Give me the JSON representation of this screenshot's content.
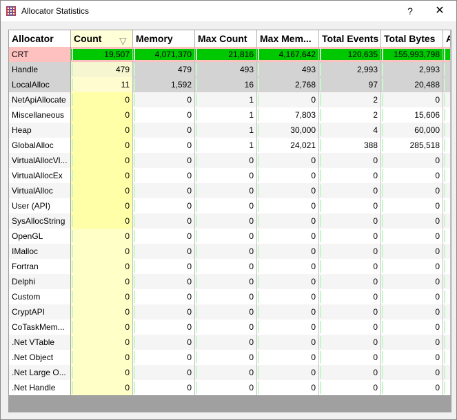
{
  "window": {
    "title": "Allocator Statistics",
    "help_label": "?",
    "close_label": "✕",
    "icon": "grid-icon"
  },
  "columns": [
    "Allocator",
    "Count",
    "Memory",
    "Max Count",
    "Max Mem...",
    "Total Events",
    "Total Bytes",
    "A"
  ],
  "sort": {
    "column": "Count",
    "direction": "descending",
    "icon": "sort-down-triangle-icon"
  },
  "colors": {
    "highlight_row": "#ffc0c0",
    "bar": "#00c800",
    "selected_rows": "#d3d3d3",
    "sort_column": "#ffffa8"
  },
  "rows": [
    [
      "CRT",
      "19,507",
      "4,071,370",
      "21,816",
      "4,167,642",
      "120,635",
      "155,993,798"
    ],
    [
      "Handle",
      "479",
      "479",
      "493",
      "493",
      "2,993",
      "2,993"
    ],
    [
      "LocalAlloc",
      "11",
      "1,592",
      "16",
      "2,768",
      "97",
      "20,488"
    ],
    [
      "NetApiAllocate",
      "0",
      "0",
      "1",
      "0",
      "2",
      "0"
    ],
    [
      "Miscellaneous",
      "0",
      "0",
      "1",
      "7,803",
      "2",
      "15,606"
    ],
    [
      "Heap",
      "0",
      "0",
      "1",
      "30,000",
      "4",
      "60,000"
    ],
    [
      "GlobalAlloc",
      "0",
      "0",
      "1",
      "24,021",
      "388",
      "285,518"
    ],
    [
      "VirtualAllocVl...",
      "0",
      "0",
      "0",
      "0",
      "0",
      "0"
    ],
    [
      "VirtualAllocEx",
      "0",
      "0",
      "0",
      "0",
      "0",
      "0"
    ],
    [
      "VirtualAlloc",
      "0",
      "0",
      "0",
      "0",
      "0",
      "0"
    ],
    [
      "User (API)",
      "0",
      "0",
      "0",
      "0",
      "0",
      "0"
    ],
    [
      "SysAllocString",
      "0",
      "0",
      "0",
      "0",
      "0",
      "0"
    ],
    [
      "OpenGL",
      "0",
      "0",
      "0",
      "0",
      "0",
      "0"
    ],
    [
      "IMalloc",
      "0",
      "0",
      "0",
      "0",
      "0",
      "0"
    ],
    [
      "Fortran",
      "0",
      "0",
      "0",
      "0",
      "0",
      "0"
    ],
    [
      "Delphi",
      "0",
      "0",
      "0",
      "0",
      "0",
      "0"
    ],
    [
      "Custom",
      "0",
      "0",
      "0",
      "0",
      "0",
      "0"
    ],
    [
      "CryptAPI",
      "0",
      "0",
      "0",
      "0",
      "0",
      "0"
    ],
    [
      "CoTaskMem...",
      "0",
      "0",
      "0",
      "0",
      "0",
      "0"
    ],
    [
      ".Net VTable",
      "0",
      "0",
      "0",
      "0",
      "0",
      "0"
    ],
    [
      ".Net Object",
      "0",
      "0",
      "0",
      "0",
      "0",
      "0"
    ],
    [
      ".Net Large O...",
      "0",
      "0",
      "0",
      "0",
      "0",
      "0"
    ],
    [
      ".Net Handle",
      "0",
      "0",
      "0",
      "0",
      "0",
      "0"
    ]
  ]
}
